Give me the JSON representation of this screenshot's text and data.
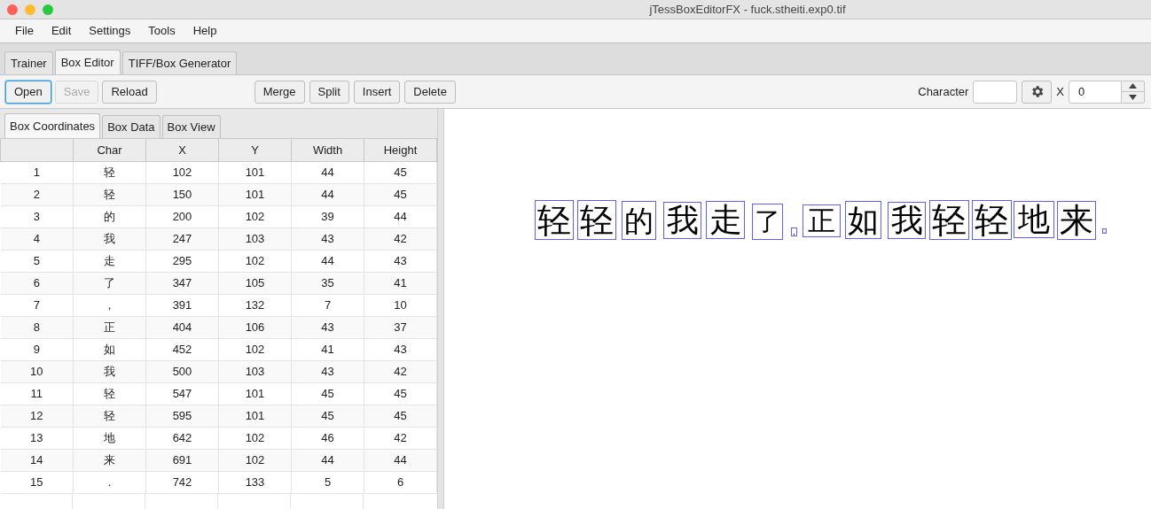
{
  "window": {
    "title": "jTessBoxEditorFX - fuck.stheiti.exp0.tif"
  },
  "menu": [
    "File",
    "Edit",
    "Settings",
    "Tools",
    "Help"
  ],
  "tabs": [
    {
      "label": "Trainer",
      "selected": false
    },
    {
      "label": "Box Editor",
      "selected": true
    },
    {
      "label": "TIFF/Box Generator",
      "selected": false
    }
  ],
  "toolbar": {
    "left_buttons": [
      {
        "label": "Open",
        "focused": true,
        "disabled": false
      },
      {
        "label": "Save",
        "focused": false,
        "disabled": true
      },
      {
        "label": "Reload",
        "focused": false,
        "disabled": false
      }
    ],
    "edit_buttons": [
      {
        "label": "Merge"
      },
      {
        "label": "Split"
      },
      {
        "label": "Insert"
      },
      {
        "label": "Delete"
      }
    ],
    "character_label": "Character",
    "x_label": "X",
    "x_value": "0"
  },
  "sub_tabs": [
    {
      "label": "Box Coordinates",
      "selected": true
    },
    {
      "label": "Box Data",
      "selected": false
    },
    {
      "label": "Box View",
      "selected": false
    }
  ],
  "table": {
    "columns": [
      "",
      "Char",
      "X",
      "Y",
      "Width",
      "Height"
    ],
    "rows": [
      [
        "1",
        "轻",
        "102",
        "101",
        "44",
        "45"
      ],
      [
        "2",
        "轻",
        "150",
        "101",
        "44",
        "45"
      ],
      [
        "3",
        "的",
        "200",
        "102",
        "39",
        "44"
      ],
      [
        "4",
        "我",
        "247",
        "103",
        "43",
        "42"
      ],
      [
        "5",
        "走",
        "295",
        "102",
        "44",
        "43"
      ],
      [
        "6",
        "了",
        "347",
        "105",
        "35",
        "41"
      ],
      [
        "7",
        "，",
        "391",
        "132",
        "7",
        "10"
      ],
      [
        "8",
        "正",
        "404",
        "106",
        "43",
        "37"
      ],
      [
        "9",
        "如",
        "452",
        "102",
        "41",
        "43"
      ],
      [
        "10",
        "我",
        "500",
        "103",
        "43",
        "42"
      ],
      [
        "11",
        "轻",
        "547",
        "101",
        "45",
        "45"
      ],
      [
        "12",
        "轻",
        "595",
        "101",
        "45",
        "45"
      ],
      [
        "13",
        "地",
        "642",
        "102",
        "46",
        "42"
      ],
      [
        "14",
        "来",
        "691",
        "102",
        "44",
        "44"
      ],
      [
        "15",
        "．",
        "742",
        "133",
        "5",
        "6"
      ]
    ]
  },
  "image": {
    "glyphs": [
      "轻",
      "轻",
      "的",
      "我",
      "走",
      "了",
      ",",
      "正",
      "如",
      "我",
      "轻",
      "轻",
      "地",
      "来",
      "."
    ]
  }
}
